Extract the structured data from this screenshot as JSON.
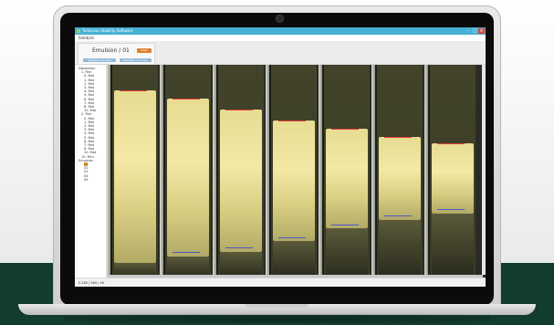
{
  "window": {
    "title": "Turbiscan Stability Software",
    "controls": {
      "minimize": "–",
      "maximize": "□",
      "close": "×"
    }
  },
  "menubar": {
    "items": [
      "Sidebars"
    ]
  },
  "toolbar": {
    "sample_title": "Emulsion / 01",
    "action_label": "Start",
    "buttons": [
      "Sample overview",
      "Stability overview"
    ]
  },
  "tree": {
    "items": [
      "Dispersion",
      "1. Film",
      "0. Mat",
      "1. Mat",
      "2. Mat",
      "3. Mat",
      "4. Mat",
      "5. Mat",
      "6. Mat",
      "7. Mat",
      "8. Mat",
      "10. Mat",
      "2. Film",
      "0. Mat",
      "1. Mat",
      "2. Mat",
      "3. Mat",
      "4. Mat",
      "5. Mat",
      "6. Mat",
      "7. Mat",
      "8. Mat",
      "10. Mat",
      "10. Film",
      "Emulsion",
      "01",
      "02",
      "03",
      "04",
      "05"
    ]
  },
  "viewer": {
    "samples": [
      {
        "id": 1,
        "top": 0.12,
        "bottom": 0.93,
        "red": 0.12,
        "blue": null
      },
      {
        "id": 2,
        "top": 0.16,
        "bottom": 0.9,
        "red": 0.16,
        "blue": 0.88
      },
      {
        "id": 3,
        "top": 0.21,
        "bottom": 0.88,
        "red": 0.21,
        "blue": 0.86
      },
      {
        "id": 4,
        "top": 0.26,
        "bottom": 0.83,
        "red": 0.26,
        "blue": 0.81
      },
      {
        "id": 5,
        "top": 0.3,
        "bottom": 0.77,
        "red": 0.3,
        "blue": 0.75
      },
      {
        "id": 6,
        "top": 0.34,
        "bottom": 0.73,
        "red": 0.34,
        "blue": 0.71
      },
      {
        "id": 7,
        "top": 0.37,
        "bottom": 0.7,
        "red": 0.37,
        "blue": 0.68
      }
    ]
  },
  "status": {
    "text": "0.260 | 560 | 56"
  },
  "colors": {
    "accent": "#47b0d6",
    "button_orange": "#e0802c",
    "button_blue": "#93b9d8",
    "marker_red": "#e53e3e",
    "marker_blue": "#4b58c9"
  }
}
